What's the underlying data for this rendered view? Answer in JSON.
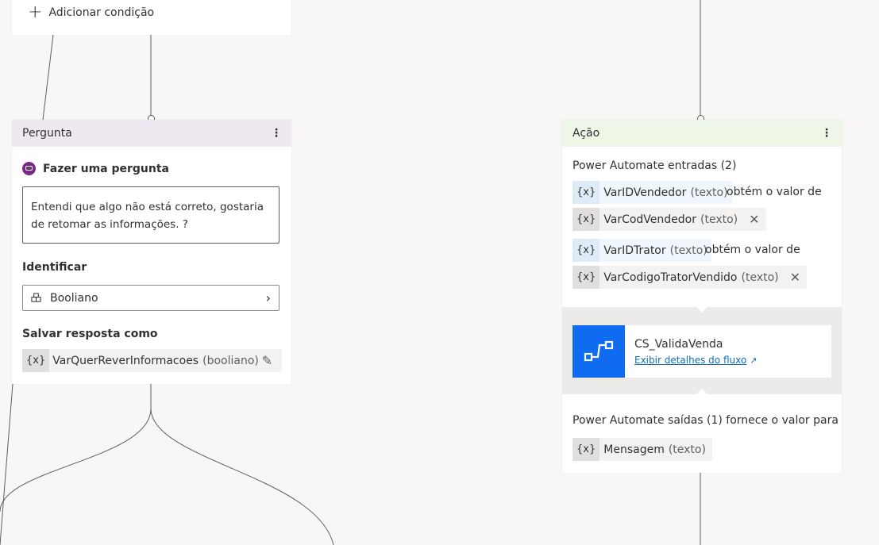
{
  "condition": {
    "add_label": "Adicionar condição"
  },
  "question": {
    "header": "Pergunta",
    "title": "Fazer uma pergunta",
    "text": "Entendi que algo não está correto, gostaria de retomar as informações. ?",
    "identify_label": "Identificar",
    "identify_value": "Booliano",
    "save_label": "Salvar resposta como",
    "save_var": {
      "icon_text": "{x}",
      "name": "VarQuerReverInformacoes",
      "type": "(booliano)"
    }
  },
  "action": {
    "header": "Ação",
    "inputs_heading": "Power Automate entradas (2)",
    "gets_value_text": "obtém o valor de",
    "inputs": [
      {
        "target": {
          "icon_text": "{x}",
          "name": "VarIDVendedor",
          "type": "(texto)"
        },
        "source": {
          "icon_text": "{x}",
          "name": "VarCodVendedor",
          "type": "(texto)"
        }
      },
      {
        "target": {
          "icon_text": "{x}",
          "name": "VarIDTrator",
          "type": "(texto)"
        },
        "source": {
          "icon_text": "{x}",
          "name": "VarCodigoTratorVendido",
          "type": "(texto)"
        }
      }
    ],
    "flow": {
      "name": "CS_ValidaVenda",
      "link": "Exibir detalhes do fluxo"
    },
    "outputs_heading": "Power Automate saídas (1) fornece o valor para",
    "outputs": [
      {
        "icon_text": "{x}",
        "name": "Mensagem",
        "type": "(texto)"
      }
    ]
  },
  "colors": {
    "question_header": "#efe8f0",
    "action_header": "#eef6e8",
    "flow_icon": "#0f6cf0",
    "link": "#0f6cbd",
    "canvas": "#f8f7f6"
  }
}
